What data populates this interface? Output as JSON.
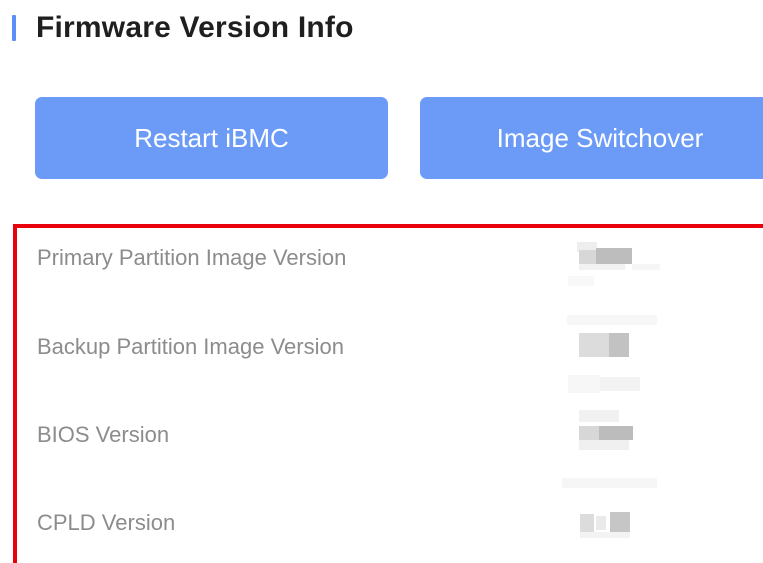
{
  "section": {
    "title": "Firmware Version Info"
  },
  "buttons": {
    "restart_label": "Restart iBMC",
    "switchover_label": "Image Switchover"
  },
  "firmware": {
    "rows": [
      {
        "label": "Primary Partition Image Version"
      },
      {
        "label": "Backup Partition Image Version"
      },
      {
        "label": "BIOS Version"
      },
      {
        "label": "CPLD Version"
      }
    ]
  },
  "colors": {
    "accent": "#5b8ef6",
    "button": "#6b9bf7",
    "highlight": "#e8000b",
    "label": "#8c8c8c"
  }
}
